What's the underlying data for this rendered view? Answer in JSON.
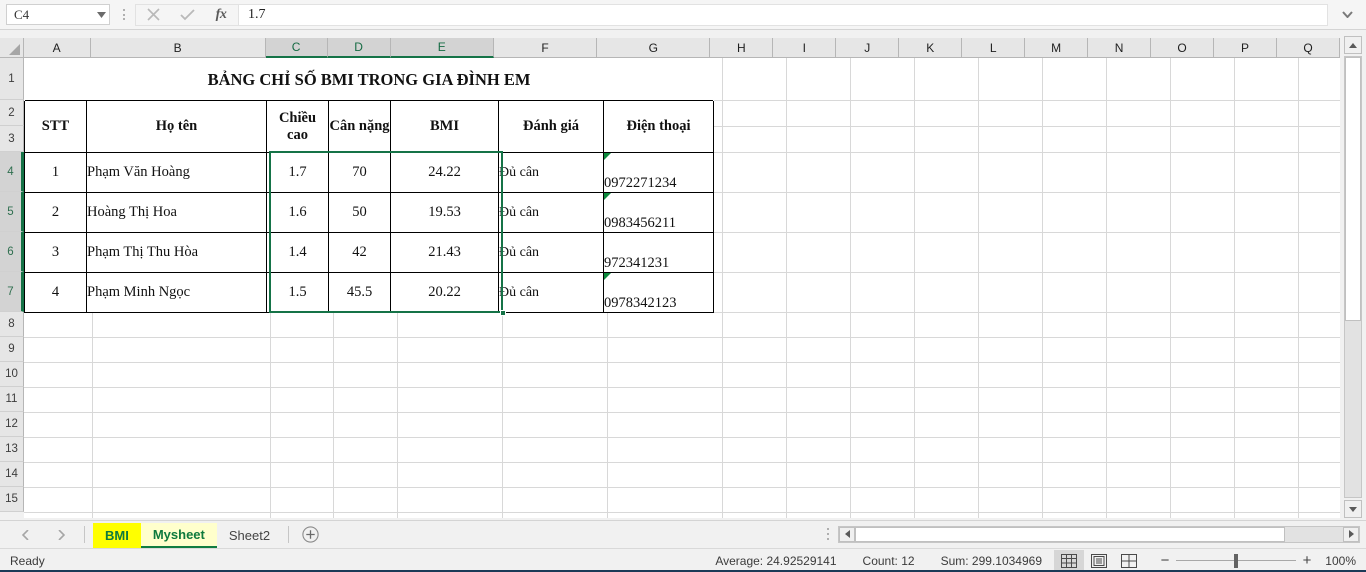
{
  "formula_bar": {
    "name_box": "C4",
    "formula_value": "1.7",
    "cancel_icon": "cancel-x-icon",
    "confirm_icon": "check-icon",
    "function_icon": "fx-icon",
    "expand_icon": "chevron-down-icon"
  },
  "grid": {
    "columns": [
      "A",
      "B",
      "C",
      "D",
      "E",
      "F",
      "G",
      "H",
      "I",
      "J",
      "K",
      "L",
      "M",
      "N",
      "O",
      "P",
      "Q"
    ],
    "selected_columns": [
      "C",
      "D",
      "E"
    ],
    "rows": [
      "1",
      "2",
      "3",
      "4",
      "5",
      "6",
      "7",
      "8",
      "9",
      "10",
      "11",
      "12",
      "13",
      "14",
      "15"
    ],
    "selected_rows": [
      "4",
      "5",
      "6",
      "7"
    ]
  },
  "table": {
    "title": "BẢNG CHỈ SỐ BMI TRONG GIA ĐÌNH EM",
    "headers": [
      "STT",
      "Họ tên",
      "Chiều cao",
      "Cân nặng",
      "BMI",
      "Đánh giá",
      "Điện thoại"
    ],
    "rows": [
      {
        "stt": "1",
        "name": "Phạm Văn Hoàng",
        "height": "1.7",
        "weight": "70",
        "bmi": "24.22",
        "rating": "Đủ cân",
        "phone": "0972271234",
        "phone_error": true
      },
      {
        "stt": "2",
        "name": "Hoàng Thị Hoa",
        "height": "1.6",
        "weight": "50",
        "bmi": "19.53",
        "rating": "Đủ cân",
        "phone": "0983456211",
        "phone_error": true
      },
      {
        "stt": "3",
        "name": "Phạm  Thị Thu Hòa",
        "height": "1.4",
        "weight": "42",
        "bmi": "21.43",
        "rating": "Đủ cân",
        "phone": "972341231",
        "phone_error": false
      },
      {
        "stt": "4",
        "name": "Phạm Minh Ngọc",
        "height": "1.5",
        "weight": "45.5",
        "bmi": "20.22",
        "rating": "Đủ cân",
        "phone": "0978342123",
        "phone_error": true
      }
    ]
  },
  "sheet_tabs": {
    "prev_icon": "chevron-left-icon",
    "next_icon": "chevron-right-icon",
    "tabs": [
      {
        "label": "BMI",
        "state": "colored"
      },
      {
        "label": "Mysheet",
        "state": "active"
      },
      {
        "label": "Sheet2",
        "state": "normal"
      }
    ],
    "add_sheet_icon": "plus-circle-icon"
  },
  "status_bar": {
    "mode": "Ready",
    "average": "Average: 24.92529141",
    "count": "Count: 12",
    "sum": "Sum: 299.1034969",
    "views": [
      {
        "name": "normal-view",
        "icon": "grid-icon",
        "active": true
      },
      {
        "name": "page-layout-view",
        "icon": "page-icon",
        "active": false
      },
      {
        "name": "page-break-view",
        "icon": "pagebreak-icon",
        "active": false
      }
    ],
    "zoom_out": "−",
    "zoom_in": "+",
    "zoom_level": "100%"
  },
  "colors": {
    "selection_green": "#157347",
    "tab_yellow": "#ffff00",
    "selected_cell_gray": "#c8c8c8",
    "error_triangle": "#0b8a3c"
  }
}
